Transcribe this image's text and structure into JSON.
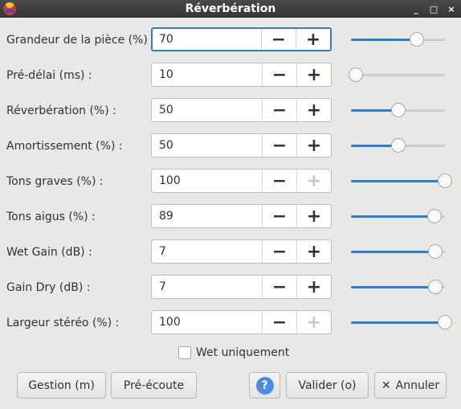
{
  "window": {
    "title": "Réverbération",
    "app_icon": "audacity-icon",
    "controls": {
      "minimize": "_",
      "maximize": "□",
      "close": "×"
    }
  },
  "params": [
    {
      "label": "Grandeur de la pièce (%) :",
      "value": "70",
      "slider_fraction": 0.7,
      "focused": true,
      "plus_disabled": false
    },
    {
      "label": "Pré-délai (ms) :",
      "value": "10",
      "slider_fraction": 0.05,
      "focused": false,
      "plus_disabled": false
    },
    {
      "label": "Réverbération (%) :",
      "value": "50",
      "slider_fraction": 0.5,
      "focused": false,
      "plus_disabled": false
    },
    {
      "label": "Amortissement (%) :",
      "value": "50",
      "slider_fraction": 0.5,
      "focused": false,
      "plus_disabled": false
    },
    {
      "label": "Tons graves (%) :",
      "value": "100",
      "slider_fraction": 1.0,
      "focused": false,
      "plus_disabled": true
    },
    {
      "label": "Tons aigus (%) :",
      "value": "89",
      "slider_fraction": 0.89,
      "focused": false,
      "plus_disabled": false
    },
    {
      "label": "Wet Gain (dB) :",
      "value": "7",
      "slider_fraction": 0.9,
      "focused": false,
      "plus_disabled": false
    },
    {
      "label": "Gain Dry (dB) :",
      "value": "7",
      "slider_fraction": 0.9,
      "focused": false,
      "plus_disabled": false
    },
    {
      "label": "Largeur stéréo (%) :",
      "value": "100",
      "slider_fraction": 1.0,
      "focused": false,
      "plus_disabled": true
    }
  ],
  "spin_glyphs": {
    "minus": "−",
    "plus": "+"
  },
  "wet_only": {
    "label": "Wet uniquement",
    "checked": false
  },
  "buttons": {
    "manage": "Gestion (m)",
    "preview": "Pré-écoute",
    "help": "?",
    "ok": "Valider (o)",
    "cancel": "Annuler",
    "cancel_icon": "✕"
  },
  "colors": {
    "accent": "#3d7ab8",
    "help": "#4b8be0",
    "titlebar": "#3c3c3c"
  }
}
